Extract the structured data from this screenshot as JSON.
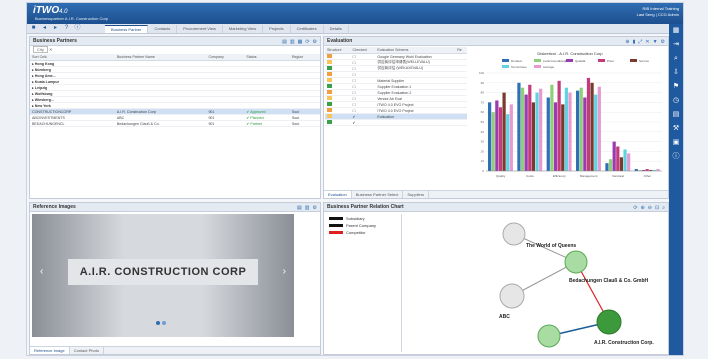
{
  "app": {
    "logo": "iTWO",
    "logo_version": "4.0",
    "company": "Businesspartner A.I.R. Construction Corp",
    "user_line1": "RIB Internal Training",
    "user_line2": "Last Seng | CCG Admin"
  },
  "toolbar_tabs": [
    "Business Partner",
    "Contacts",
    "Procurement View",
    "Marketing View",
    "Projects",
    "Certificates",
    "Details"
  ],
  "business_partners": {
    "title": "Business Partners",
    "filter_label": "City",
    "columns": [
      "Sort Ceik",
      "Business Partner Name",
      "Company",
      "Status",
      "Region"
    ],
    "groups": [
      "Hong Kong",
      "Nürnberg",
      "Hong Ame...",
      "Kuala Lumpur",
      "Leipzig",
      "Wolfsburg",
      "Wiesberg...",
      "New York"
    ],
    "rows": [
      {
        "code": "CONSTRUCTIONCORP",
        "name": "A.I.R. Construction Corp",
        "company": "901",
        "status": "Approved",
        "region": "Sout"
      },
      {
        "code": "ABCINVESTMENTS",
        "name": "ABC",
        "company": "901",
        "status": "Planned",
        "region": "Sout"
      },
      {
        "code": "BEDACHUNGENCL",
        "name": "Bedachungen Clauß & Co.",
        "company": "901",
        "status": "Partner",
        "region": "Sout"
      }
    ]
  },
  "evaluation": {
    "title": "Evaluation",
    "columns": [
      "Structure",
      "Checked",
      "Evaluation Schema",
      "Re"
    ],
    "items": [
      {
        "label": "Google Germany Wohl Evaluation",
        "checked": false
      },
      {
        "label": "供应商评估申请表(WELLEVALU)",
        "checked": false
      },
      {
        "label": "供应商评估 (WEKAXEVALU)",
        "checked": false
      },
      {
        "label": "",
        "checked": false
      },
      {
        "label": "Material Supplier",
        "checked": false
      },
      {
        "label": "Supplier Evaluation 1",
        "checked": false
      },
      {
        "label": "Supplier Evaluation 2",
        "checked": false
      },
      {
        "label": "Vendor Ab Eval",
        "checked": false
      },
      {
        "label": "ITWO 4.0 EVO Project",
        "checked": false
      },
      {
        "label": "ITWO 4.0 EVO Project",
        "checked": false
      },
      {
        "label": "Evaluation",
        "checked": true
      },
      {
        "label": "",
        "checked": true
      }
    ],
    "subtabs": [
      "Evaluation",
      "Business Partner Select",
      "Suppliers"
    ]
  },
  "chart_data": {
    "type": "bar",
    "title": "Diskreticol - A.I.R. Construction Corp",
    "categories": [
      "Quality",
      "Costs",
      "Efficiency",
      "Management",
      "Vendorat",
      "Other"
    ],
    "series": [
      {
        "name": "Duration",
        "color": "#2f6fb5",
        "values": [
          70,
          90,
          75,
          82,
          8,
          2
        ]
      },
      {
        "name": "Lieferzuverlässigkeit",
        "color": "#8fce7a",
        "values": [
          60,
          85,
          88,
          85,
          12,
          1
        ]
      },
      {
        "name": "Qualität",
        "color": "#9c3bb0",
        "values": [
          72,
          78,
          70,
          75,
          30,
          1
        ]
      },
      {
        "name": "Preis",
        "color": "#c23b7a",
        "values": [
          65,
          88,
          92,
          95,
          25,
          2
        ]
      },
      {
        "name": "Service",
        "color": "#7a3b2e",
        "values": [
          80,
          70,
          68,
          90,
          14,
          1
        ]
      },
      {
        "name": "Termintreue",
        "color": "#5fd3e0",
        "values": [
          58,
          80,
          85,
          78,
          22,
          1
        ]
      },
      {
        "name": "Average",
        "color": "#e69ad0",
        "values": [
          68,
          84,
          80,
          86,
          18,
          2
        ]
      }
    ],
    "ylim": [
      0,
      100
    ],
    "yticks": [
      0,
      10,
      20,
      30,
      40,
      50,
      60,
      70,
      80,
      90,
      100
    ],
    "legend": "top"
  },
  "reference_images": {
    "title": "Reference Images",
    "company_logo_text": "A.I.R. CONSTRUCTION CORP",
    "subtabs": [
      "Reference Image",
      "Contact Photo"
    ]
  },
  "relation_chart": {
    "title": "Business Partner Relation Chart",
    "legend": [
      {
        "label": "Subsidiary",
        "color": "#111111"
      },
      {
        "label": "Parent Company",
        "color": "#111111"
      },
      {
        "label": "Competitor",
        "color": "#e02020"
      }
    ],
    "nodes": [
      "The World of Queens",
      "Bedachungen Clauß & Co. GmbH",
      "ABC",
      "A.I.R. Construction Corp."
    ]
  },
  "sidebar_icons": [
    "grid-icon",
    "exit-icon",
    "search-icon",
    "download-icon",
    "flag-icon",
    "clock-icon",
    "document-icon",
    "wrench-icon",
    "calendar-icon",
    "info-icon"
  ]
}
